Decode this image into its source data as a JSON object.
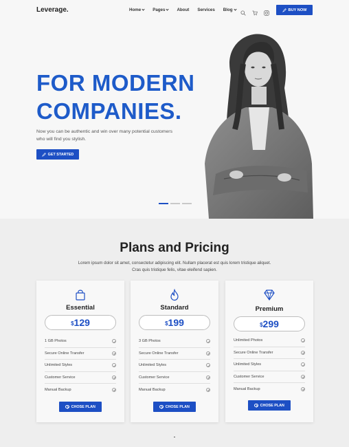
{
  "brand": {
    "logo": "Leverage.",
    "accent": "#1d4fc4"
  },
  "nav": {
    "items": [
      {
        "label": "Home",
        "dropdown": true
      },
      {
        "label": "Pages",
        "dropdown": true
      },
      {
        "label": "About",
        "dropdown": false
      },
      {
        "label": "Services",
        "dropdown": false
      },
      {
        "label": "Blog",
        "dropdown": true
      }
    ],
    "icons": [
      "search-icon",
      "cart-icon",
      "instagram-icon"
    ],
    "cta": "BUY NOW"
  },
  "hero": {
    "title_line1": "FOR MODERN",
    "title_line2": "COMPANIES.",
    "subtitle": "Now you can be authentic and win over many potential customers who will find you stylish.",
    "cta": "GET STARTED",
    "slides": 3,
    "active_slide": 1
  },
  "pricing": {
    "title": "Plans and Pricing",
    "description": "Lorem ipsum dolor sit amet, consectetur adipiscing elit. Nullam placerat est quis lorem tristique aliquet. Cras quis tristique felis, vitae eleifend sapien.",
    "plans": [
      {
        "name": "Essential",
        "icon": "shopping-bag-icon",
        "currency": "$",
        "price": "129",
        "features": [
          "1 GB Photos",
          "Secure Online Transfer",
          "Unlimited Styles",
          "Customer Service",
          "Manual Backup"
        ],
        "cta": "CHOSE PLAN"
      },
      {
        "name": "Standard",
        "icon": "flame-icon",
        "currency": "$",
        "price": "199",
        "features": [
          "3 GB Photos",
          "Secure Online Transfer",
          "Unlimited Styles",
          "Customer Service",
          "Manual Backup"
        ],
        "cta": "CHOSE PLAN"
      },
      {
        "name": "Premium",
        "icon": "diamond-icon",
        "currency": "$",
        "price": "299",
        "features": [
          "Unlimited Photos",
          "Secure Online Transfer",
          "Unlimited Styles",
          "Customer Service",
          "Manual Backup"
        ],
        "cta": "CHOSE PLAN"
      }
    ]
  }
}
